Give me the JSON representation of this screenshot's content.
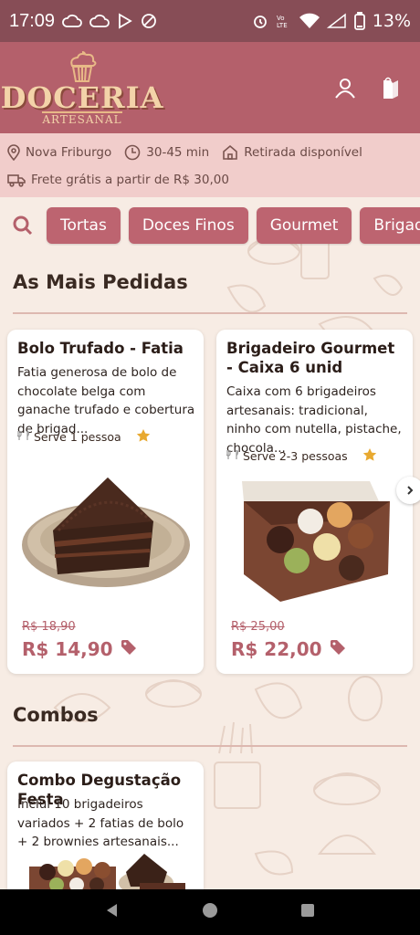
{
  "status_bar": {
    "time": "17:09",
    "battery": "13%"
  },
  "header": {
    "brand": "DOCERIA",
    "brand_sub": "ARTESANAL",
    "profile_icon": "user-icon",
    "bag_icon": "shopping-bag-icon"
  },
  "info": {
    "location": "Nova Friburgo",
    "delivery_time": "30-45 min",
    "pickup": "Retirada disponível",
    "free_shipping": "Frete grátis a partir de R$ 30,00"
  },
  "categories": [
    "Tortas",
    "Doces Finos",
    "Gourmet",
    "Brigadeiros"
  ],
  "sections": {
    "most_ordered": {
      "title": "As Mais Pedidas",
      "products": [
        {
          "name": "Bolo Trufado - Fatia",
          "description": "Fatia generosa de bolo de chocolate belga com ganache trufado e cobertura de brigad...",
          "serves": "Serve 1 pessoa",
          "old_price": "R$ 18,90",
          "price": "R$ 14,90"
        },
        {
          "name": "Brigadeiro Gourmet - Caixa 6 unid",
          "description": "Caixa com 6 brigadeiros artesanais: tradicional, ninho com nutella, pistache, chocola...",
          "serves": "Serve 2-3 pessoas",
          "old_price": "R$ 25,00",
          "price": "R$ 22,00"
        }
      ]
    },
    "combos": {
      "title": "Combos",
      "products": [
        {
          "name": "Combo Degustação Festa",
          "description": "Inclui 10 brigadeiros variados + 2 fatias de bolo + 2 brownies artesanais..."
        }
      ]
    }
  },
  "colors": {
    "primary": "#b4606b",
    "status_bar": "#874d56",
    "info_bar": "#f1cdcb",
    "background": "#f7ece4"
  }
}
